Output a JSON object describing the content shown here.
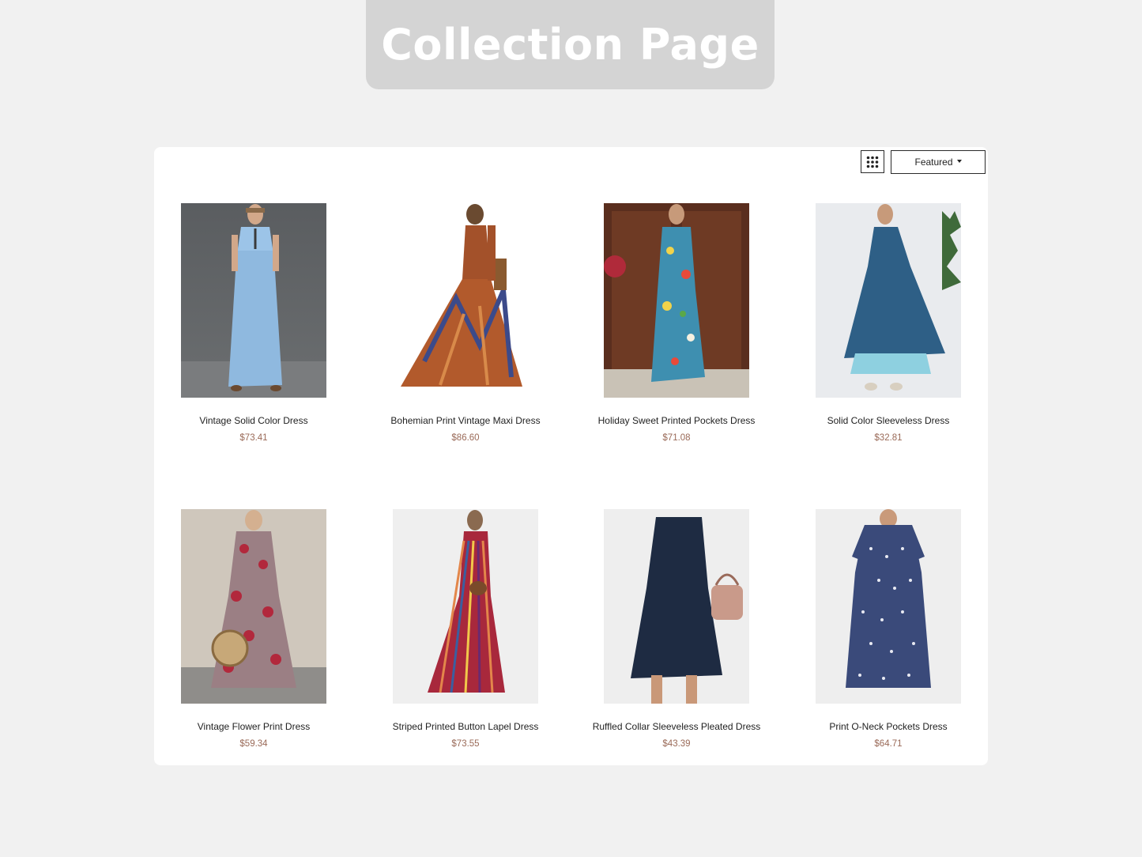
{
  "banner": {
    "title": "Collection Page"
  },
  "toolbar": {
    "grid_icon": "grid-view-icon",
    "sort_label": "Featured",
    "sort_icon": "caret-down-icon"
  },
  "colors": {
    "background": "#f1f1f1",
    "banner": "#d4d4d4",
    "panel": "#ffffff",
    "price": "#9a6a58"
  },
  "products": [
    {
      "name": "Vintage Solid Color Dress",
      "price": "$73.41"
    },
    {
      "name": "Bohemian Print Vintage Maxi Dress",
      "price": "$86.60"
    },
    {
      "name": "Holiday Sweet Printed Pockets Dress",
      "price": "$71.08"
    },
    {
      "name": "Solid Color Sleeveless Dress",
      "price": "$32.81"
    },
    {
      "name": "Vintage Flower Print Dress",
      "price": "$59.34"
    },
    {
      "name": "Striped Printed Button Lapel Dress",
      "price": "$73.55"
    },
    {
      "name": "Ruffled Collar Sleeveless Pleated Dress",
      "price": "$43.39"
    },
    {
      "name": "Print O-Neck Pockets Dress",
      "price": "$64.71"
    }
  ]
}
